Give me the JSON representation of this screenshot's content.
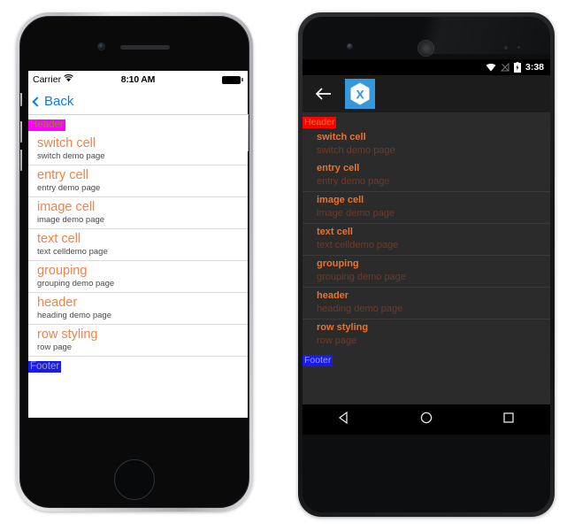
{
  "ios": {
    "status": {
      "carrier": "Carrier",
      "wifi_icon": "wifi-icon",
      "time": "8:10 AM",
      "battery_icon": "battery-full-icon"
    },
    "nav": {
      "back_label": "Back",
      "back_icon": "chevron-left-icon"
    },
    "list": {
      "header": "Header",
      "footer": "Footer",
      "rows": [
        {
          "title": "switch cell",
          "subtitle": "switch demo page"
        },
        {
          "title": "entry cell",
          "subtitle": "entry demo page"
        },
        {
          "title": "image cell",
          "subtitle": "image demo page"
        },
        {
          "title": "text cell",
          "subtitle": "text celldemo page"
        },
        {
          "title": "grouping",
          "subtitle": "grouping demo page"
        },
        {
          "title": "header",
          "subtitle": "heading demo page"
        },
        {
          "title": "row styling",
          "subtitle": "row page"
        }
      ]
    },
    "colors": {
      "header_bg": "#ff00ff",
      "header_text": "#8a8a2a",
      "footer_bg": "#1a1aee",
      "footer_text": "#9e9eb0",
      "row_title": "#f4804a",
      "row_subtitle": "#4a4a4a",
      "accent": "#007aff"
    }
  },
  "android": {
    "status": {
      "wifi_icon": "wifi-icon",
      "signal_icon": "signal-off-icon",
      "battery_icon": "battery-charging-icon",
      "time": "3:38"
    },
    "actionbar": {
      "back_icon": "arrow-left-icon",
      "app_logo": "xamarin-logo-icon"
    },
    "list": {
      "header": "Header",
      "footer": "Footer",
      "rows": [
        {
          "title": "switch cell",
          "subtitle": "switch demo page",
          "separator": false
        },
        {
          "title": "entry cell",
          "subtitle": "entry demo page",
          "separator": false
        },
        {
          "title": "image cell",
          "subtitle": "image demo page",
          "separator": true
        },
        {
          "title": "text cell",
          "subtitle": "text celldemo page",
          "separator": true
        },
        {
          "title": "grouping",
          "subtitle": "grouping demo page",
          "separator": true
        },
        {
          "title": "header",
          "subtitle": "heading demo page",
          "separator": true
        },
        {
          "title": "row styling",
          "subtitle": "row page",
          "separator": true
        }
      ]
    },
    "navbar": {
      "back_icon": "nav-back-triangle-icon",
      "home_icon": "nav-home-circle-icon",
      "recents_icon": "nav-recents-square-icon"
    },
    "colors": {
      "header_bg": "#ff0000",
      "header_text": "#e8732e",
      "footer_bg": "#1a1aee",
      "footer_text": "#a0a0b4",
      "row_title": "#e8732e",
      "row_subtitle": "#6b3b2b",
      "logo_bg": "#3498db"
    }
  }
}
